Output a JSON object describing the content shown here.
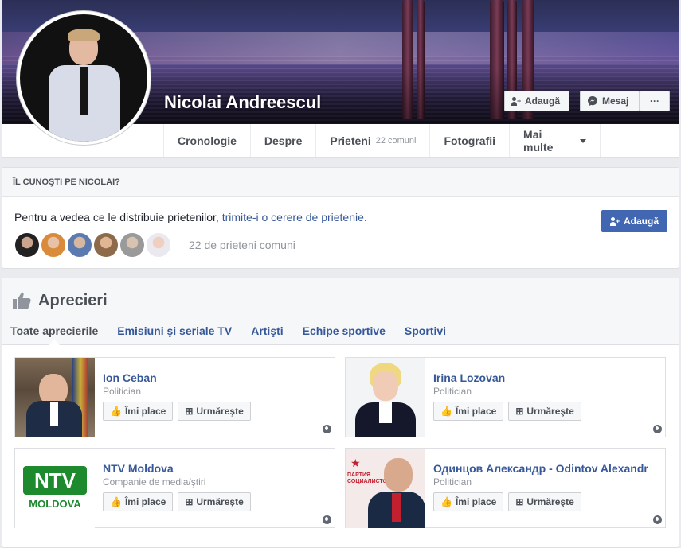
{
  "profile": {
    "name": "Nicolai Andreescul",
    "add_button": "Adaugă",
    "message_button": "Mesaj",
    "more_button": "···"
  },
  "nav": {
    "items": [
      "Cronologie",
      "Despre",
      "Prieteni",
      "Fotografii",
      "Mai multe"
    ],
    "friends_sub": "22 comuni"
  },
  "know": {
    "header": "ÎL CUNOŞTI PE NICOLAI?",
    "text": "Pentru a vedea ce le distribuie prietenilor, ",
    "link": "trimite-i o cerere de prietenie.",
    "add_button": "Adaugă",
    "mutual_count": "22 de prieteni comuni"
  },
  "likes": {
    "title": "Aprecieri",
    "tabs": [
      "Toate aprecierile",
      "Emisiuni şi seriale TV",
      "Artişti",
      "Echipe sportive",
      "Sportivi"
    ],
    "like_label": "Îmi place",
    "follow_label": "Urmăreşte",
    "pages": [
      {
        "name": "Ion Ceban",
        "category": "Politician"
      },
      {
        "name": "Irina Lozovan",
        "category": "Politician"
      },
      {
        "name": "NTV Moldova",
        "category": "Companie de media/ştiri"
      },
      {
        "name": "Одинцов Александр - Odintov Alexandr",
        "category": "Politician"
      }
    ],
    "ntv_logo_top": "NTV",
    "ntv_logo_bottom": "MOLDOVA",
    "party_text": "ПАРТИЯ СОЦИАЛИСТОВ"
  },
  "colors": {
    "link": "#365899",
    "button_blue": "#4267b2",
    "page_bg": "#e9ebee"
  }
}
